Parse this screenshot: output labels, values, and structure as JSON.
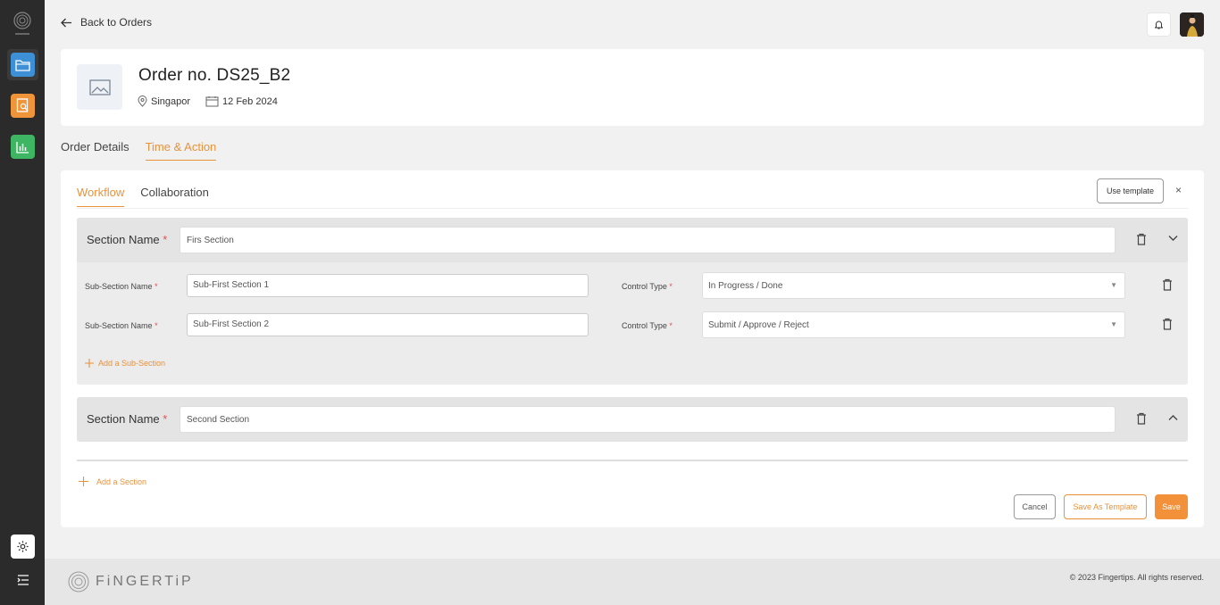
{
  "back_link": {
    "label": "Back to Orders"
  },
  "order": {
    "title": "Order no. DS25_B2",
    "location": "Singapor",
    "date": "12 Feb 2024"
  },
  "top_tabs": [
    {
      "label": "Order Details",
      "active": false
    },
    {
      "label": "Time & Action",
      "active": true
    }
  ],
  "inner_tabs": [
    {
      "label": "Workflow",
      "active": true
    },
    {
      "label": "Collaboration",
      "active": false
    }
  ],
  "buttons": {
    "use_template": "Use template",
    "close": "×",
    "add_sub_section": "Add a Sub-Section",
    "add_section": "Add a Section",
    "cancel": "Cancel",
    "save_as_template": "Save As Template",
    "save": "Save"
  },
  "labels": {
    "section_name": "Section Name",
    "sub_section_name": "Sub-Section Name",
    "control_type": "Control Type",
    "required": "*"
  },
  "sections": [
    {
      "name": "Firs Section",
      "expanded": true,
      "sub_sections": [
        {
          "name": "Sub-First Section 1",
          "control_type": "In Progress / Done"
        },
        {
          "name": "Sub-First Section 2",
          "control_type": "Submit / Approve / Reject"
        }
      ]
    },
    {
      "name": "Second Section",
      "expanded": false
    }
  ],
  "footer": {
    "brand": "FiNGERTiP",
    "copyright": "© 2023 Fingertips. All rights reserved."
  },
  "colors": {
    "accent": "#e8923a",
    "sidebar": "#2b2b2b",
    "nav_folder": "#3d8fd6",
    "nav_report": "#f0943a",
    "nav_chart": "#3eb563",
    "required": "#e05252"
  },
  "icons": [
    "app-logo-icon",
    "folder-icon",
    "report-search-icon",
    "bar-chart-icon",
    "gear-icon",
    "menu-icon",
    "arrow-left-icon",
    "bell-icon",
    "image-placeholder-icon",
    "location-pin-icon",
    "calendar-icon",
    "trash-icon",
    "chevron-down-icon",
    "chevron-up-icon",
    "plus-icon"
  ]
}
